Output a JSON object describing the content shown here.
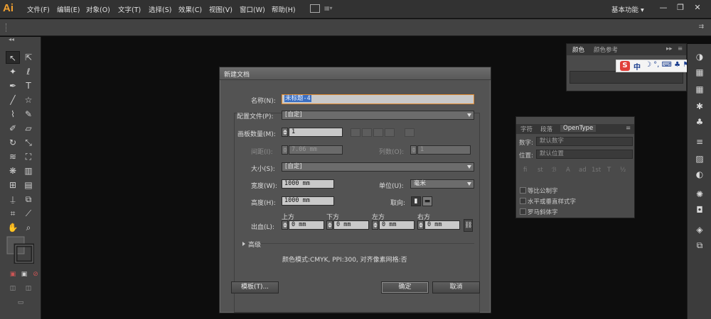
{
  "app": {
    "logo": "Ai",
    "workspace": "基本功能"
  },
  "menus": [
    "文件(F)",
    "编辑(E)",
    "对象(O)",
    "文字(T)",
    "选择(S)",
    "效果(C)",
    "视图(V)",
    "窗口(W)",
    "帮助(H)"
  ],
  "window_controls": {
    "minimize": "—",
    "restore": "❐",
    "close": "✕"
  },
  "color_panel": {
    "tabs": [
      "颜色",
      "颜色参考"
    ]
  },
  "ime": {
    "logo": "S",
    "mode": "中"
  },
  "char_panel": {
    "tabs": [
      "字符",
      "段落",
      "OpenType"
    ],
    "digits_label": "数字:",
    "digits_value": "默认数字",
    "position_label": "位置:",
    "position_value": "默认位置",
    "glyph_buttons": [
      "fi",
      "st",
      "ℬ",
      "A",
      "ad",
      "1st",
      "T",
      "½"
    ],
    "checkboxes": [
      "等比公制字",
      "水平或垂直样式字",
      "罗马斜体字"
    ]
  },
  "dialog": {
    "title": "新建文档",
    "name_label": "名称(N):",
    "name_value": "未标题-4",
    "profile_label": "配置文件(P):",
    "profile_value": "[自定]",
    "artboards_label": "画板数量(M):",
    "artboards_value": "1",
    "spacing_label": "间距(I):",
    "spacing_value": "7.06 mm",
    "columns_label": "列数(O):",
    "columns_value": "1",
    "size_label": "大小(S):",
    "size_value": "[自定]",
    "width_label": "宽度(W):",
    "width_value": "1000 mm",
    "units_label": "单位(U):",
    "units_value": "毫米",
    "height_label": "高度(H):",
    "height_value": "1000 mm",
    "orientation_label": "取向:",
    "bleed_label": "出血(L):",
    "bleed_top_label": "上方",
    "bleed_bottom_label": "下方",
    "bleed_left_label": "左方",
    "bleed_right_label": "右方",
    "bleed_top": "0 mm",
    "bleed_bottom": "0 mm",
    "bleed_left": "0 mm",
    "bleed_right": "0 mm",
    "advanced_label": "高级",
    "doc_info": "颜色模式:CMYK, PPI:300, 对齐像素网格:否",
    "template_button": "模板(T)...",
    "ok_button": "确定",
    "cancel_button": "取消"
  }
}
